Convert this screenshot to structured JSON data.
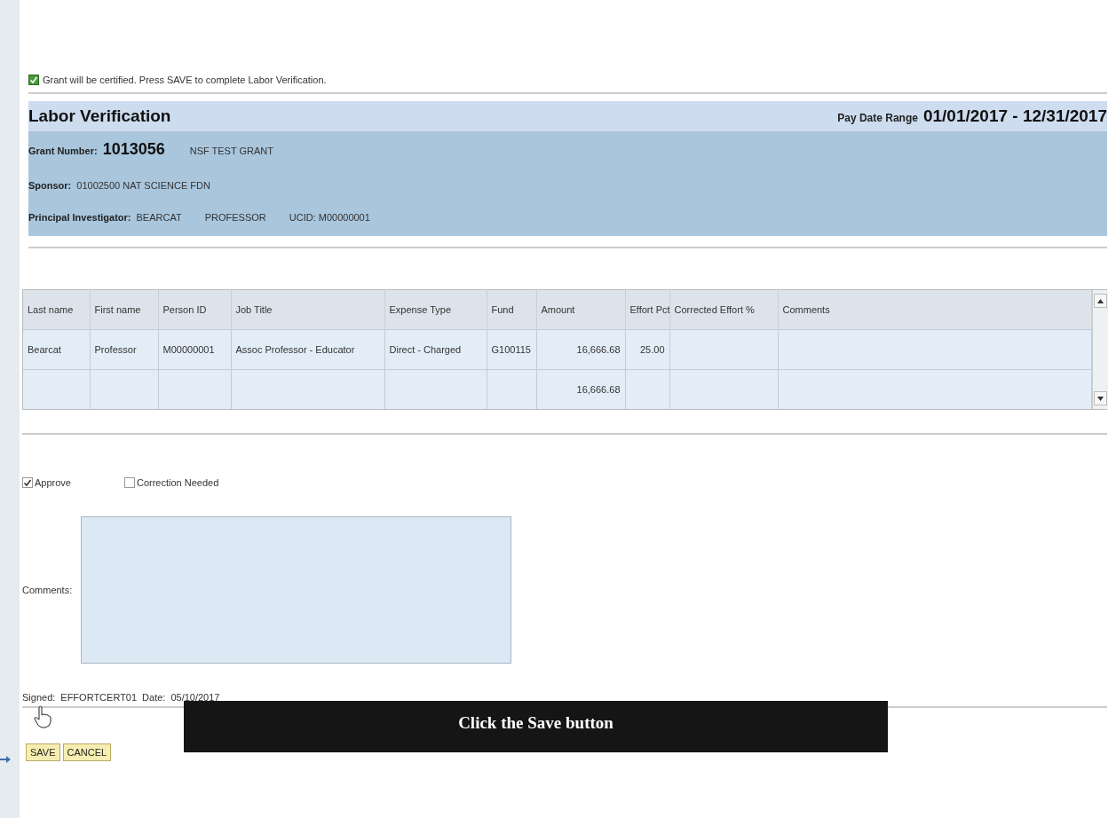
{
  "message": {
    "checked": true,
    "text": "Grant will be certified. Press SAVE to complete Labor Verification."
  },
  "header": {
    "title": "Labor Verification",
    "date_range_label": "Pay Date Range",
    "date_range": "01/01/2017 - 12/31/2017",
    "grant_number_label": "Grant Number:",
    "grant_number": "1013056",
    "grant_name": "NSF TEST GRANT",
    "sponsor_label": "Sponsor:",
    "sponsor": "01002500 NAT SCIENCE FDN",
    "pi_label": "Principal Investigator:",
    "pi_last": "BEARCAT",
    "pi_first": "PROFESSOR",
    "ucid": "UCID: M00000001"
  },
  "table": {
    "columns": [
      "Last name",
      "First name",
      "Person ID",
      "Job Title",
      "Expense Type",
      "Fund",
      "Amount",
      "Effort Pct",
      "Corrected Effort %",
      "Comments"
    ],
    "rows": [
      [
        "Bearcat",
        "Professor",
        "M00000001",
        "Assoc Professor - Educator",
        "Direct - Charged",
        "G100115",
        "16,666.68",
        "25.00",
        "",
        ""
      ],
      [
        "",
        "",
        "",
        "",
        "",
        "",
        "16,666.68",
        "",
        "",
        ""
      ]
    ]
  },
  "options": [
    {
      "label": "Approve",
      "checked": true
    },
    {
      "label": "Correction Needed",
      "checked": false
    }
  ],
  "comments": {
    "label": "Comments:"
  },
  "signed": {
    "label": "Signed:",
    "user": "EFFORTCERT01",
    "date_label": "Date:",
    "date": "05/10/2017"
  },
  "buttons": [
    "SAVE",
    "CANCEL"
  ],
  "tooltip": "Click the Save button"
}
